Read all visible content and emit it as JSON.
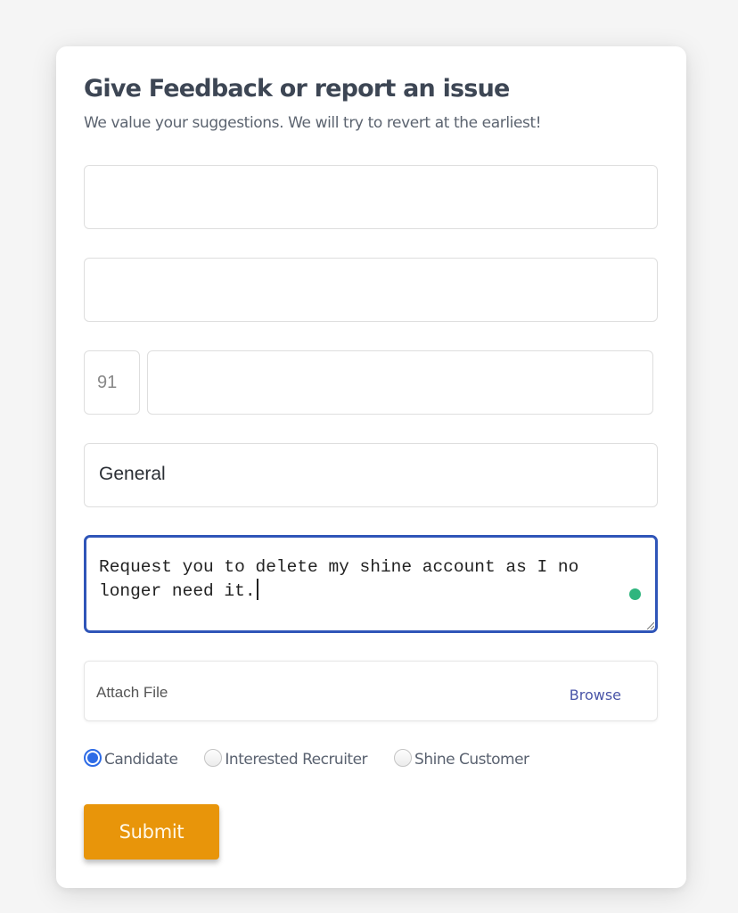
{
  "form": {
    "title": "Give Feedback or report an issue",
    "subtitle": "We value your suggestions. We will try to revert at the earliest!",
    "fields": {
      "name": {
        "value": ""
      },
      "email": {
        "value": ""
      },
      "country_code": {
        "value": "91"
      },
      "phone": {
        "value": ""
      },
      "category": {
        "value": "General"
      },
      "message": {
        "value": "Request you to delete my shine account as I no longer need it."
      }
    },
    "attachment": {
      "label": "Attach File",
      "browse_label": "Browse"
    },
    "user_type": {
      "options": [
        {
          "label": "Candidate",
          "checked": true
        },
        {
          "label": "Interested Recruiter",
          "checked": false
        },
        {
          "label": "Shine Customer",
          "checked": false
        }
      ]
    },
    "submit_label": "Submit"
  },
  "colors": {
    "accent": "#e8950a",
    "focus_border": "#2f55b8",
    "radio_checked": "#2d6be6",
    "link": "#4a55a8",
    "status_dot": "#2fb57e"
  },
  "icons": {
    "status_dot": "green-status-dot-icon",
    "resize": "resize-handle-icon"
  }
}
